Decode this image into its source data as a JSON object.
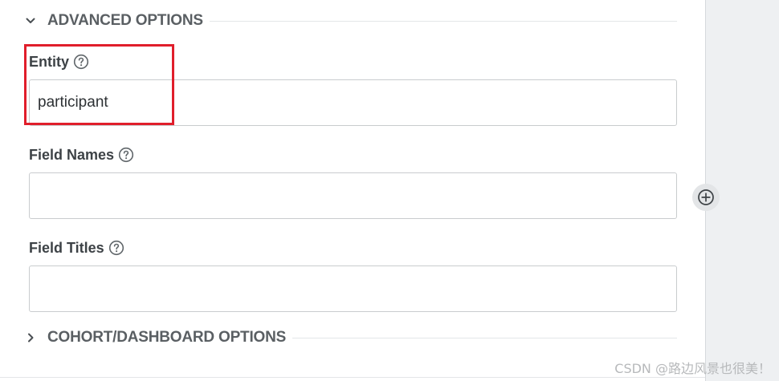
{
  "sections": {
    "advanced": {
      "title": "ADVANCED OPTIONS",
      "expanded": true,
      "icon": "chevron-down-icon"
    },
    "cohort": {
      "title": "COHORT/DASHBOARD OPTIONS",
      "expanded": false,
      "icon": "chevron-right-icon"
    }
  },
  "fields": {
    "entity": {
      "label": "Entity",
      "value": "participant",
      "placeholder": "",
      "help_icon": "help-icon"
    },
    "field_names": {
      "label": "Field Names",
      "value": "",
      "placeholder": "",
      "help_icon": "help-icon"
    },
    "field_titles": {
      "label": "Field Titles",
      "value": "",
      "placeholder": "",
      "help_icon": "help-icon"
    }
  },
  "add_button": {
    "icon": "plus-circle-icon"
  },
  "watermark": "CSDN @路边风景也很美！",
  "colors": {
    "highlight": "#e01e2b",
    "side_panel": "#eef0f2",
    "text": "#3d4246",
    "border": "#c9ccce"
  }
}
